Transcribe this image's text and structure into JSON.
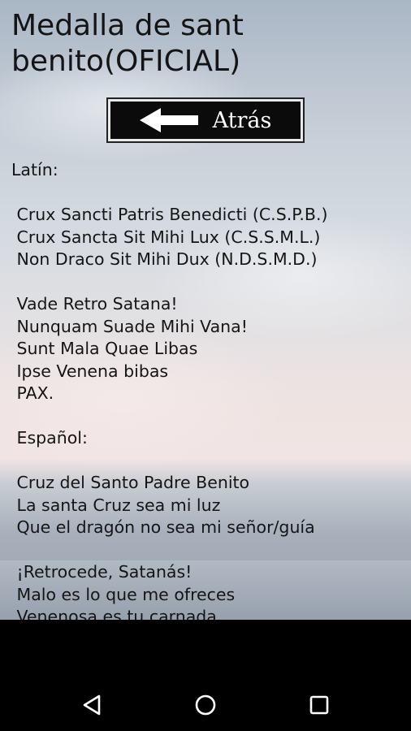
{
  "header": {
    "title": "Medalla de sant benito(OFICIAL)"
  },
  "back_button": {
    "label": "Atrás",
    "icon": "arrow-left-icon"
  },
  "content": {
    "lines": [
      "Latín:",
      "",
      " Crux Sancti Patris Benedicti (C.S.P.B.)",
      " Crux Sancta Sit Mihi Lux (C.S.S.M.L.)",
      " Non Draco Sit Mihi Dux (N.D.S.M.D.)",
      "",
      " Vade Retro Satana!",
      " Nunquam Suade Mihi Vana!",
      " Sunt Mala Quae Libas",
      " Ipse Venena bibas",
      " PAX.",
      "",
      " Español:",
      "",
      " Cruz del Santo Padre Benito",
      " La santa Cruz sea mi luz",
      " Que el dragón no sea mi señor/guía",
      "",
      " ¡Retrocede, Satanás!",
      " Malo es lo que me ofreces",
      " Venenosa es tu carnada"
    ]
  },
  "navbar": {
    "back": "back-triangle-icon",
    "home": "home-circle-icon",
    "recents": "recents-square-icon"
  },
  "colors": {
    "background_top": "#a9b6c4",
    "button_bg": "#0b0b0b",
    "navbar_bg": "#000000"
  }
}
